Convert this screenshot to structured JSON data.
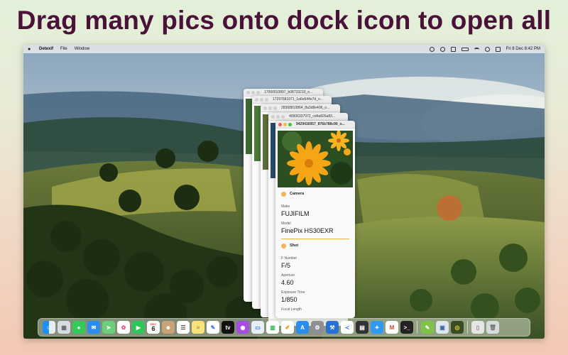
{
  "headline": "Drag many pics onto dock icon to open all",
  "menubar": {
    "app_name": "Detexif",
    "menus": [
      "File",
      "Window"
    ],
    "datetime": "Fri 8 Dec  8:42 PM"
  },
  "windows_back": [
    {
      "title": "17000010897_b08733210_o..."
    },
    {
      "title": "17297681971_1a6e644e7d_o..."
    },
    {
      "title": "28368810864_8a3d8e406_o..."
    },
    {
      "title": "40906337972_cd4a826a83..."
    }
  ],
  "front_window": {
    "title": "9429416957_876b788c90_o...",
    "sections": {
      "camera": "Camera",
      "shot": "Shot"
    },
    "fields": {
      "make_label": "Make",
      "make_value": "FUJIFILM",
      "model_label": "Model",
      "model_value": "FinePix HS30EXR",
      "fnumber_label": "F Number",
      "fnumber_value": "F/5",
      "aperture_label": "Aperture",
      "aperture_value": "4.60",
      "exposure_label": "Exposure Time",
      "exposure_value": "1/850",
      "focal_label": "Focal Length"
    }
  },
  "dock": {
    "calendar_month": "DEC",
    "calendar_day": "6"
  },
  "colors": {
    "headline": "#4a1238",
    "accent_line": "#f0b44a"
  }
}
